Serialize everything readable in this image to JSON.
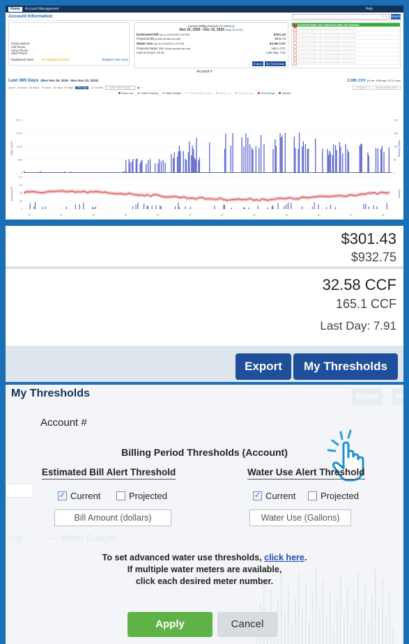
{
  "topnav": {
    "home": "Home",
    "menu": "Account Management",
    "help": "Help"
  },
  "account_info": {
    "title": "Account Information",
    "search_button": "Search",
    "contact_labels": [
      "Email Address",
      "Cell Phone",
      "Home Phone",
      "Work Phone"
    ],
    "registered_label": "Registered Users",
    "registered_value": "No Registered Users",
    "register_link": "[Register New User]"
  },
  "billing": {
    "period_label": "Current Billing Period",
    "period_link": "(All Meters)",
    "period_dates": "Nov 10, 2020 - Dec 10, 2020",
    "period_day": "(Day 14 of 31)",
    "estimated_label": "Estimated Bill",
    "estimated_asof": "(as of 11/23/2020 1:00 PM)",
    "estimated_value": "$301.43",
    "projected_label": "Projected Bill",
    "projected_note": "(at last reported use rate)",
    "projected_value": "$932.75",
    "water_use_label": "Water Use",
    "water_use_asof": "(as of 11/23/2020 1:00 PM)",
    "water_use_value": "32.58 CCF",
    "projected_water_label": "Projected Water Use",
    "projected_water_note": "(at last reported use rate)",
    "projected_water_value": "165.1 CCF",
    "last24_label": "Last 24 Hours: 12.61",
    "last_day": "Last Day: 7.91",
    "export": "Export",
    "thresholds": "My Thresholds",
    "account_num": "Account #"
  },
  "alerts": [
    "11/23/2020  Water Use: Abnormal water use detected",
    "11/22/2020  Water Use: Abnormal water use detected",
    "11/21/2020  Water Use: Abnormal water use detected",
    "11/20/2020  Water Use: Abnormal water use detected",
    "11/19/2020  Water Use: Abnormal water use detected",
    "11/18/2020  Water Use: Abnormal water use detected",
    "11/17/2020  Water Use: Abnormal water use detected",
    "11/16/2020  Water Use: Abnormal water use detected",
    "11/15/2020  Water Use: Abnormal water use detected",
    "11/14/2020  Water Use: Abnormal water use detected"
  ],
  "range": {
    "title": "Last 365 Days",
    "dates": "(Mon Nov 25, 2019 - Mon Nov 23, 2020)",
    "total": "2,385 CCF",
    "total_note": "(9 min, 6.55 avg, 23.11 max)"
  },
  "tools": {
    "zoom": "Zoom",
    "options": [
      "24 hours",
      "48 hours",
      "72 hours",
      "30 days",
      "90 days",
      "365 days",
      "12 months"
    ],
    "selected": "365 days",
    "date_placeholder": "Enter date to view",
    "right": [
      "Compare",
      "Accumulating View"
    ]
  },
  "legend": [
    {
      "label": "Water Use",
      "color": "#3d4fb0",
      "kind": "dot",
      "dim": false
    },
    {
      "label": "Water Reading",
      "color": "#3d4fb0",
      "kind": "line",
      "dim": false
    },
    {
      "label": "Water Budget",
      "color": "#c8553d",
      "kind": "line",
      "dim": false
    },
    {
      "label": "Water Budget Today",
      "color": "#c9c9c9",
      "kind": "line",
      "dim": true
    },
    {
      "label": "Billing Day",
      "color": "#c9c9c9",
      "kind": "dot",
      "dim": true
    },
    {
      "label": "Watering Day",
      "color": "#c9c9c9",
      "kind": "dot",
      "dim": true
    },
    {
      "label": "Temp Range",
      "color": "#c0303a",
      "kind": "dot",
      "dim": false
    },
    {
      "label": "Rainfall",
      "color": "#3d4fb0",
      "kind": "dot",
      "dim": false
    }
  ],
  "chart_data": {
    "type": "bar",
    "ylabel_top": "Water (CCF)",
    "ylabel_top_right": "Water Reading",
    "ylabel_bottom": "Avg Temp (F)",
    "ylabel_bottom_right": "Rainfall",
    "y_ticks_top": [
      "26.71",
      "20.03",
      "13.35",
      "6.68",
      "0"
    ],
    "y_ticks_right": [
      "20k",
      "15k",
      "10k",
      "5k",
      "0"
    ],
    "y_ticks_bottom": [
      "120",
      "90",
      "60",
      "30",
      "0"
    ],
    "x_ticks": [
      "Dec '19",
      "Jan '20",
      "Feb '20",
      "Mar '20",
      "Apr '20",
      "May '20",
      "Jun '20",
      "Jul '20",
      "Aug '20",
      "Sep '20",
      "Oct '20",
      "Nov '20"
    ],
    "ylim": [
      0,
      26.71
    ]
  },
  "thresholds": {
    "title": "My Thresholds",
    "account": "Account #",
    "subtitle": "Billing Period Thresholds (Account)",
    "bill_header": "Estimated Bill Alert Threshold",
    "water_header": "Water Use Alert Threshold",
    "current": "Current",
    "projected": "Projected",
    "bill_placeholder": "Bill Amount (dollars)",
    "water_placeholder": "Water Use (Gallons)",
    "note_line1": "To set advanced water use thresholds, ",
    "note_link": "click here",
    "note_line1_end": ".",
    "note_line2": "If multiple water meters are available,",
    "note_line3": "click each desired meter number.",
    "apply": "Apply",
    "cancel": "Cancel",
    "ghost_export": "Export",
    "ghost_my": "My",
    "ghost_billing": "ling",
    "ghost_budget": "— Water Budget"
  }
}
